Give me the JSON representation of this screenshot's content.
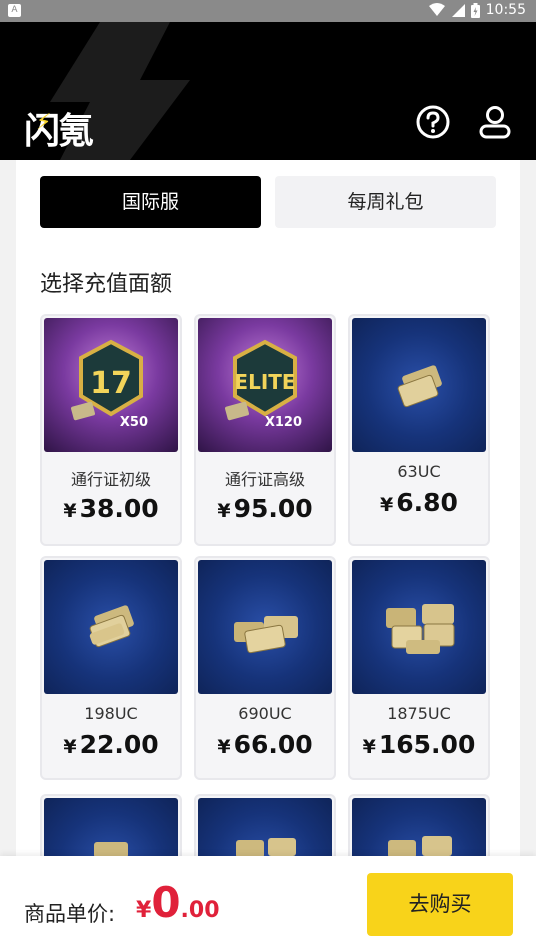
{
  "status_bar": {
    "time": "10:55",
    "app_indicator": "A",
    "icons": [
      "wifi-icon",
      "signal-icon",
      "battery-icon"
    ]
  },
  "header": {
    "logo_text": "闪氪",
    "icons": [
      "help-circle-icon",
      "user-icon"
    ]
  },
  "tabs": [
    {
      "label": "国际服",
      "active": true
    },
    {
      "label": "每周礼包",
      "active": false
    }
  ],
  "section_title": "选择充值面额",
  "products": [
    {
      "name": "通行证初级",
      "currency": "¥",
      "price": "38.00",
      "badge": "X50",
      "emblem": "17",
      "style": "purple"
    },
    {
      "name": "通行证高级",
      "currency": "¥",
      "price": "95.00",
      "badge": "X120",
      "emblem": "ELITE",
      "style": "purple"
    },
    {
      "name": "63UC",
      "currency": "¥",
      "price": "6.80",
      "style": "blue"
    },
    {
      "name": "198UC",
      "currency": "¥",
      "price": "22.00",
      "style": "blue"
    },
    {
      "name": "690UC",
      "currency": "¥",
      "price": "66.00",
      "style": "blue"
    },
    {
      "name": "1875UC",
      "currency": "¥",
      "price": "165.00",
      "style": "blue"
    }
  ],
  "bottom_bar": {
    "unit_price_label": "商品单价:",
    "currency": "¥",
    "total_int": "0",
    "total_dec": ".00",
    "buy_label": "去购买"
  },
  "colors": {
    "accent_yellow": "#f8d31a",
    "price_red": "#e0213a",
    "header_black": "#000000"
  }
}
